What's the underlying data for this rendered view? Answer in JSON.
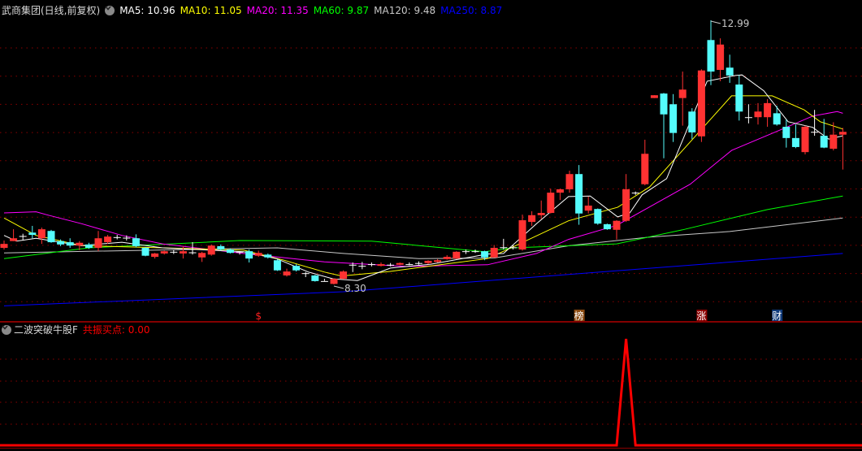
{
  "header": {
    "title": "武商集团(日线,前复权)",
    "ma": [
      {
        "label": "MA5: 10.96",
        "color": "#ffffff"
      },
      {
        "label": "MA10: 11.05",
        "color": "#ffff00"
      },
      {
        "label": "MA20: 11.35",
        "color": "#ff00ff"
      },
      {
        "label": "MA60: 9.87",
        "color": "#00ff00"
      },
      {
        "label": "MA120: 9.48",
        "color": "#c8c8c8"
      },
      {
        "label": "MA250: 8.87",
        "color": "#0000ff"
      }
    ]
  },
  "indicator": {
    "name": "二波突破牛股F",
    "line_label": "共振买点: 0.00",
    "color": "#ff0000"
  },
  "colors": {
    "up": "#ff3232",
    "down": "#54fcfc",
    "doji": "#ffffff",
    "grid": "#8b0000",
    "separator": "#b00000"
  },
  "chart_data": [
    {
      "type": "candlestick",
      "title": "武商集团(日线,前复权)",
      "ohlc_format": [
        "open",
        "high",
        "low",
        "close"
      ],
      "candles": [
        [
          8.95,
          9.08,
          8.92,
          9.02
        ],
        [
          9.07,
          9.28,
          9.07,
          9.12
        ],
        [
          9.15,
          9.2,
          9.08,
          9.16
        ],
        [
          9.22,
          9.34,
          9.12,
          9.18
        ],
        [
          9.12,
          9.31,
          9.02,
          9.28
        ],
        [
          9.25,
          9.27,
          9.04,
          9.05
        ],
        [
          9.07,
          9.1,
          8.98,
          9.01
        ],
        [
          9.05,
          9.12,
          8.95,
          8.99
        ],
        [
          8.99,
          9.07,
          8.91,
          9.04
        ],
        [
          9.01,
          9.04,
          8.93,
          8.95
        ],
        [
          8.95,
          9.25,
          8.89,
          9.12
        ],
        [
          9.05,
          9.18,
          9.02,
          9.15
        ],
        [
          9.13,
          9.18,
          9.1,
          9.14
        ],
        [
          9.13,
          9.17,
          9.08,
          9.13
        ],
        [
          9.12,
          9.19,
          8.96,
          8.98
        ],
        [
          8.95,
          8.96,
          8.8,
          8.81
        ],
        [
          8.79,
          8.86,
          8.76,
          8.85
        ],
        [
          8.85,
          8.9,
          8.83,
          8.89
        ],
        [
          8.88,
          8.91,
          8.84,
          8.88
        ],
        [
          8.85,
          8.98,
          8.76,
          8.89
        ],
        [
          8.86,
          9.05,
          8.83,
          8.87
        ],
        [
          8.78,
          8.88,
          8.7,
          8.86
        ],
        [
          8.83,
          9.01,
          8.81,
          8.99
        ],
        [
          8.98,
          9.01,
          8.9,
          8.92
        ],
        [
          8.92,
          8.94,
          8.85,
          8.86
        ],
        [
          8.87,
          8.89,
          8.83,
          8.88
        ],
        [
          8.89,
          8.92,
          8.69,
          8.76
        ],
        [
          8.81,
          8.9,
          8.79,
          8.86
        ],
        [
          8.83,
          8.85,
          8.76,
          8.78
        ],
        [
          8.73,
          8.75,
          8.54,
          8.55
        ],
        [
          8.46,
          8.58,
          8.44,
          8.53
        ],
        [
          8.63,
          8.66,
          8.53,
          8.55
        ],
        [
          8.5,
          8.52,
          8.43,
          8.49
        ],
        [
          8.46,
          8.47,
          8.35,
          8.36
        ],
        [
          8.36,
          8.4,
          8.36,
          8.36
        ],
        [
          8.31,
          8.41,
          8.3,
          8.4
        ],
        [
          8.4,
          8.55,
          8.39,
          8.53
        ],
        [
          8.65,
          8.69,
          8.52,
          8.64
        ],
        [
          8.62,
          8.7,
          8.57,
          8.63
        ],
        [
          8.66,
          8.69,
          8.62,
          8.65
        ],
        [
          8.63,
          8.69,
          8.62,
          8.66
        ],
        [
          8.65,
          8.68,
          8.62,
          8.65
        ],
        [
          8.65,
          8.69,
          8.64,
          8.68
        ],
        [
          8.66,
          8.69,
          8.64,
          8.66
        ],
        [
          8.68,
          8.71,
          8.65,
          8.67
        ],
        [
          8.68,
          8.73,
          8.66,
          8.72
        ],
        [
          8.7,
          8.75,
          8.69,
          8.73
        ],
        [
          8.75,
          8.82,
          8.74,
          8.79
        ],
        [
          8.76,
          8.89,
          8.75,
          8.88
        ],
        [
          8.89,
          8.92,
          8.84,
          8.88
        ],
        [
          8.89,
          8.92,
          8.86,
          8.89
        ],
        [
          8.89,
          8.9,
          8.73,
          8.78
        ],
        [
          8.78,
          9.0,
          8.77,
          8.95
        ],
        [
          8.96,
          9.11,
          8.92,
          8.95
        ],
        [
          8.96,
          9.0,
          8.92,
          8.96
        ],
        [
          8.92,
          9.54,
          8.9,
          9.44
        ],
        [
          9.41,
          9.6,
          9.34,
          9.53
        ],
        [
          9.53,
          9.79,
          9.46,
          9.57
        ],
        [
          9.57,
          10.0,
          9.56,
          9.93
        ],
        [
          9.93,
          10.0,
          9.8,
          9.99
        ],
        [
          9.99,
          10.32,
          9.93,
          10.26
        ],
        [
          10.26,
          10.42,
          9.36,
          9.56
        ],
        [
          9.61,
          9.86,
          9.56,
          9.7
        ],
        [
          9.64,
          9.65,
          9.36,
          9.38
        ],
        [
          9.37,
          9.38,
          9.27,
          9.28
        ],
        [
          9.27,
          9.44,
          9.1,
          9.43
        ],
        [
          9.43,
          10.26,
          9.41,
          9.99
        ],
        [
          9.93,
          9.95,
          9.89,
          9.92
        ],
        [
          10.08,
          10.87,
          10.06,
          10.62
        ],
        [
          11.61,
          11.66,
          11.61,
          11.66
        ],
        [
          11.69,
          11.7,
          10.54,
          11.32
        ],
        [
          11.5,
          11.68,
          10.83,
          10.99
        ],
        [
          11.61,
          12.08,
          11.12,
          11.76
        ],
        [
          11.37,
          11.43,
          10.88,
          11.0
        ],
        [
          10.93,
          12.12,
          10.83,
          12.1
        ],
        [
          12.64,
          12.99,
          11.84,
          12.08
        ],
        [
          12.11,
          12.67,
          11.91,
          12.56
        ],
        [
          12.15,
          12.38,
          11.88,
          12.01
        ],
        [
          11.85,
          12.02,
          11.21,
          11.37
        ],
        [
          11.27,
          11.5,
          11.16,
          11.27
        ],
        [
          11.27,
          11.52,
          11.14,
          11.37
        ],
        [
          11.27,
          11.59,
          11.1,
          11.52
        ],
        [
          11.34,
          11.47,
          11.12,
          11.14
        ],
        [
          11.1,
          11.23,
          10.73,
          10.9
        ],
        [
          10.9,
          11.14,
          10.72,
          10.74
        ],
        [
          10.65,
          11.12,
          10.61,
          11.1
        ],
        [
          11.01,
          11.4,
          10.94,
          11.0
        ],
        [
          10.94,
          11.24,
          10.72,
          10.73
        ],
        [
          10.71,
          11.18,
          10.68,
          10.96
        ],
        [
          10.96,
          11.08,
          10.34,
          11.01
        ]
      ],
      "moving_averages": [
        {
          "name": "MA5",
          "color": "#ffffff",
          "points": [
            [
              1,
              9.17
            ],
            [
              2.3,
              9.07
            ],
            [
              4.4,
              9.12
            ],
            [
              9.2,
              8.99
            ],
            [
              13.5,
              9.05
            ],
            [
              17.8,
              8.95
            ],
            [
              26.4,
              8.88
            ],
            [
              29.9,
              8.76
            ],
            [
              33.3,
              8.52
            ],
            [
              35.9,
              8.4
            ],
            [
              38.5,
              8.37
            ],
            [
              42,
              8.59
            ],
            [
              46.3,
              8.66
            ],
            [
              52.3,
              8.84
            ],
            [
              54,
              8.85
            ],
            [
              57.5,
              9.38
            ],
            [
              60.9,
              9.86
            ],
            [
              63.2,
              9.87
            ],
            [
              66.1,
              9.5
            ],
            [
              67.4,
              9.57
            ],
            [
              68.7,
              9.89
            ],
            [
              71.3,
              10.18
            ],
            [
              75.6,
              11.91
            ],
            [
              78.6,
              12.01
            ],
            [
              79.3,
              12.02
            ],
            [
              81.6,
              11.74
            ],
            [
              84.2,
              11.19
            ],
            [
              86.8,
              11.09
            ],
            [
              88.5,
              10.88
            ],
            [
              90,
              10.94
            ]
          ]
        },
        {
          "name": "MA10",
          "color": "#ffff00",
          "points": [
            [
              1,
              9.48
            ],
            [
              4.4,
              9.17
            ],
            [
              9.2,
              8.99
            ],
            [
              17.8,
              8.95
            ],
            [
              26.4,
              8.91
            ],
            [
              30.7,
              8.73
            ],
            [
              35,
              8.52
            ],
            [
              36.8,
              8.45
            ],
            [
              41.9,
              8.53
            ],
            [
              46.3,
              8.63
            ],
            [
              52.3,
              8.76
            ],
            [
              55.7,
              9.02
            ],
            [
              60.9,
              9.43
            ],
            [
              66.1,
              9.67
            ],
            [
              69.5,
              10.03
            ],
            [
              73.8,
              10.83
            ],
            [
              78.2,
              11.65
            ],
            [
              82.5,
              11.65
            ],
            [
              85.9,
              11.4
            ],
            [
              87.6,
              11.19
            ],
            [
              90,
              11.06
            ]
          ]
        },
        {
          "name": "MA20",
          "color": "#ff00ff",
          "points": [
            [
              1,
              9.57
            ],
            [
              4.4,
              9.59
            ],
            [
              5.7,
              9.53
            ],
            [
              9.2,
              9.38
            ],
            [
              13.5,
              9.17
            ],
            [
              17.8,
              9.02
            ],
            [
              26.4,
              8.85
            ],
            [
              35,
              8.7
            ],
            [
              43.7,
              8.62
            ],
            [
              52.3,
              8.65
            ],
            [
              57.5,
              8.85
            ],
            [
              60.9,
              9.1
            ],
            [
              66,
              9.35
            ],
            [
              73.8,
              10.08
            ],
            [
              78.2,
              10.68
            ],
            [
              83.3,
              11.04
            ],
            [
              86.8,
              11.29
            ],
            [
              89.4,
              11.37
            ],
            [
              90,
              11.34
            ]
          ]
        },
        {
          "name": "MA60",
          "color": "#00ff00",
          "points": [
            [
              1,
              8.76
            ],
            [
              10,
              8.95
            ],
            [
              26,
              9.08
            ],
            [
              40,
              9.07
            ],
            [
              52,
              8.88
            ],
            [
              55,
              8.95
            ],
            [
              66,
              9.02
            ],
            [
              73,
              9.27
            ],
            [
              82,
              9.63
            ],
            [
              90,
              9.87
            ]
          ]
        },
        {
          "name": "MA120",
          "color": "#c8c8c8",
          "points": [
            [
              1,
              8.86
            ],
            [
              30,
              8.95
            ],
            [
              37,
              8.85
            ],
            [
              45,
              8.76
            ],
            [
              53,
              8.77
            ],
            [
              61,
              8.99
            ],
            [
              69.5,
              9.14
            ],
            [
              78,
              9.24
            ],
            [
              90,
              9.48
            ]
          ]
        },
        {
          "name": "MA250",
          "color": "#0000ff",
          "points": [
            [
              1,
              7.92
            ],
            [
              37,
              8.17
            ],
            [
              90,
              8.85
            ]
          ]
        }
      ],
      "annotations": [
        {
          "candle": 76,
          "label": "12.99",
          "kind": "high"
        },
        {
          "candle": 36,
          "label": "8.30",
          "kind": "low"
        }
      ],
      "event_markers": [
        {
          "candle": 28,
          "label": "$",
          "color": "#ff2020",
          "bg": ""
        },
        {
          "candle": 62,
          "label": "榜",
          "color": "#ffffff",
          "bg": "#8b4a10"
        },
        {
          "candle": 75,
          "label": "涨",
          "color": "#ffffff",
          "bg": "#8b0000"
        },
        {
          "candle": 83,
          "label": "财",
          "color": "#ffffff",
          "bg": "#103a7a"
        }
      ],
      "ylim": [
        7.85,
        13.35
      ],
      "grid": true
    },
    {
      "type": "line",
      "title": "二波突破牛股F",
      "series": [
        {
          "name": "共振买点",
          "color": "#ff0000",
          "points": [
            [
              1,
              0
            ],
            [
              66,
              0
            ],
            [
              67,
              1
            ],
            [
              68,
              0
            ],
            [
              90,
              0
            ]
          ]
        }
      ],
      "ylim": [
        0,
        1.15
      ],
      "grid": true
    }
  ]
}
